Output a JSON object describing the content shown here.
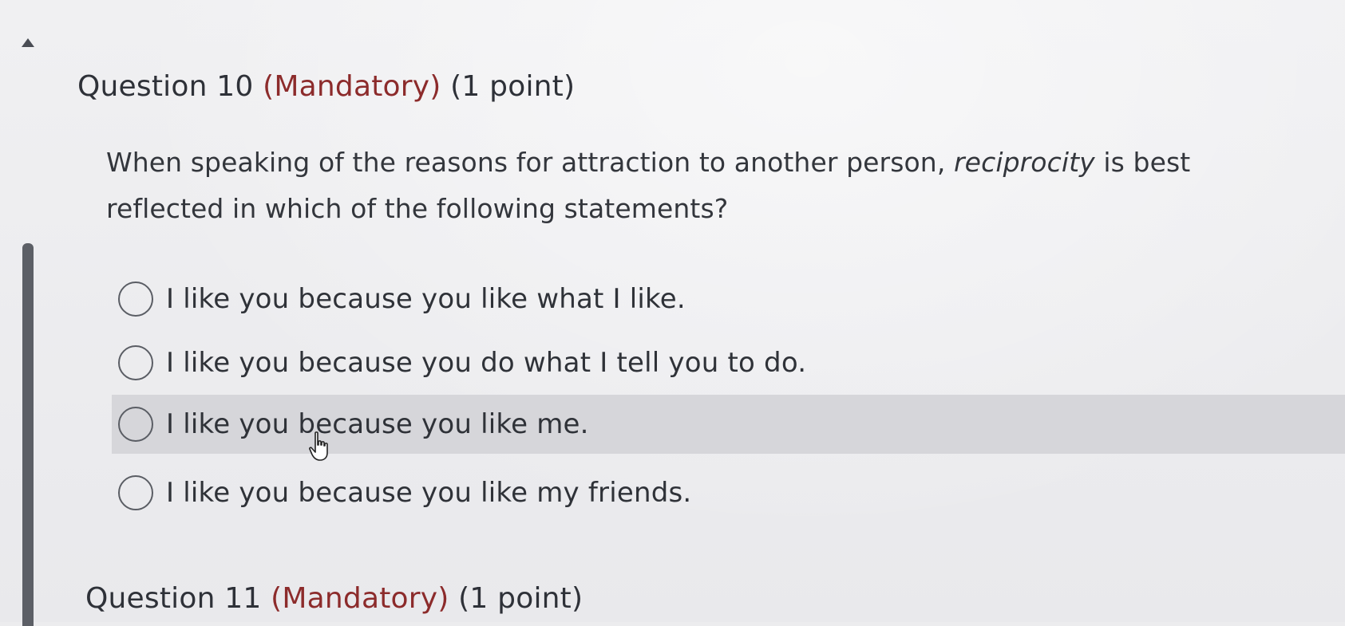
{
  "quiz": {
    "question10": {
      "number_label": "Question 10",
      "mandatory_label": "(Mandatory)",
      "points_label": "(1 point)",
      "text_before": "When speaking of the reasons for attraction to another person, ",
      "text_italic": "reciprocity",
      "text_after": " is best reflected in which of the following statements?",
      "options": [
        {
          "label": "I like you because you like what I like.",
          "selected": false
        },
        {
          "label": "I like you because you do what I tell you to do.",
          "selected": false
        },
        {
          "label": "I like you because you like me.",
          "selected": false,
          "hovered": true
        },
        {
          "label": "I like you because you like my friends.",
          "selected": false
        }
      ]
    },
    "question11": {
      "number_label": "Question 11",
      "mandatory_label": "(Mandatory)",
      "points_label": "(1 point)"
    }
  },
  "colors": {
    "mandatory": "#8c2b2b",
    "hover_row": "#d6d6da",
    "text": "#2f3238"
  },
  "icons": {
    "collapse": "triangle-up-icon",
    "cursor": "hand-pointer-icon"
  }
}
